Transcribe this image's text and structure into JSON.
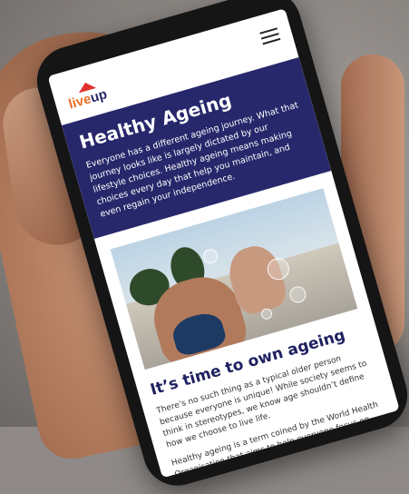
{
  "header": {
    "logo_part1": "live",
    "logo_part2": "up"
  },
  "hero": {
    "title": "Healthy Ageing",
    "body": "Everyone has a different ageing journey. What that journey looks like is largely dictated by our lifestyle choices. Healthy ageing means making choices every day that help you maintain, and even regain your independence."
  },
  "section": {
    "title": "It’s time to own ageing",
    "para1": "There’s no such thing as a typical older person because everyone is unique! While society seems to think in stereotypes, we know age shouldn’t define how we choose to live life.",
    "para2": "Healthy ageing is a term coined by the World Health Organisation that aims to help everyone focus on thriving at any age. Part of this"
  },
  "colors": {
    "hero_background": "#27286b",
    "logo_orange": "#ee6b2a",
    "logo_navy": "#2a2a6b"
  },
  "icons": {
    "menu": "hamburger-menu-icon",
    "logo_roof": "house-roof-icon"
  }
}
